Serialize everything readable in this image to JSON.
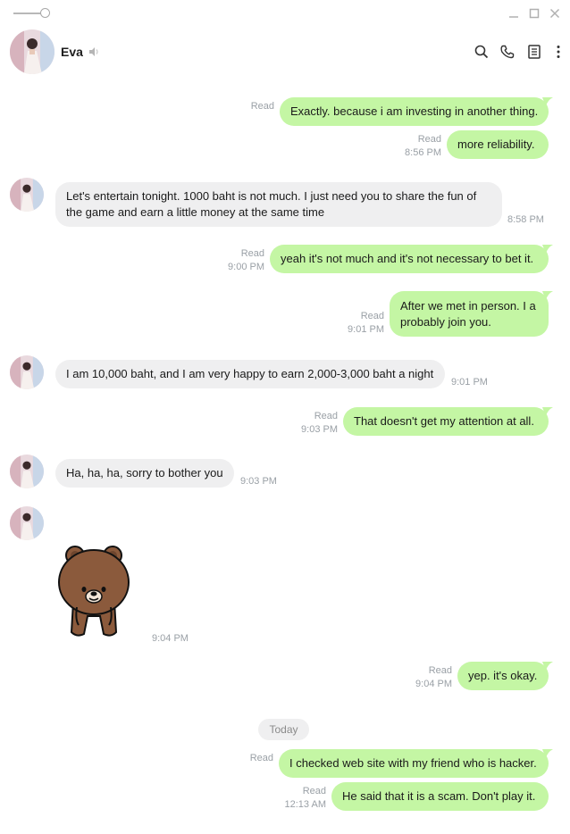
{
  "window": {
    "controls": [
      "minimize-icon",
      "maximize-icon",
      "close-icon"
    ]
  },
  "header": {
    "contact_name": "Eva",
    "icons": [
      "search-icon",
      "phone-icon",
      "notes-icon",
      "more-icon"
    ]
  },
  "colors": {
    "outgoing_bubble": "#c4f6a4",
    "incoming_bubble": "#efeff0",
    "meta_text": "#9aa0a6"
  },
  "messages": [
    {
      "dir": "out",
      "text": "Exactly. because i am investing in another thing.",
      "read": "Read",
      "time": ""
    },
    {
      "dir": "out",
      "text": "more reliability.",
      "read": "Read",
      "time": "8:56 PM"
    },
    {
      "dir": "in",
      "text": "Let's entertain tonight. 1000 baht is not much. I just need you to share the fun of the game and earn a little money at the same time",
      "time": "8:58 PM"
    },
    {
      "dir": "out",
      "text": "yeah it's not much and it's not necessary to bet it.",
      "read": "Read",
      "time": "9:00 PM"
    },
    {
      "dir": "out",
      "text": "After we met in person. I a probably join you.",
      "read": "Read",
      "time": "9:01 PM"
    },
    {
      "dir": "in",
      "text": "I am 10,000 baht, and I am very happy to earn 2,000-3,000 baht a night",
      "time": "9:01 PM"
    },
    {
      "dir": "out",
      "text": "That doesn't get my attention at all.",
      "read": "Read",
      "time": "9:03 PM"
    },
    {
      "dir": "in",
      "text": "Ha, ha, ha, sorry to bother you",
      "time": "9:03 PM"
    },
    {
      "dir": "in",
      "sticker": "brown-bear-sticker",
      "time": "9:04 PM"
    },
    {
      "dir": "out",
      "text": "yep. it's okay.",
      "read": "Read",
      "time": "9:04 PM"
    },
    {
      "dir": "out",
      "text": "I checked web site with my friend who is hacker.",
      "read": "Read",
      "time": ""
    },
    {
      "dir": "out",
      "text": "He said that it is a scam. Don't play it.",
      "read": "Read",
      "time": "12:13 AM"
    }
  ],
  "date_divider": "Today"
}
